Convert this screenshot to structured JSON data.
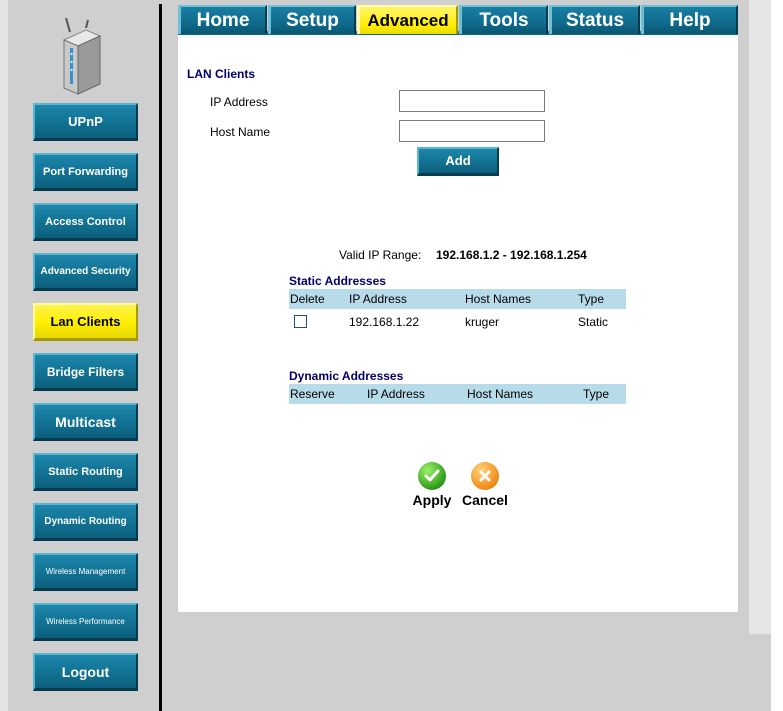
{
  "tabs": [
    {
      "label": "Home"
    },
    {
      "label": "Setup"
    },
    {
      "label": "Advanced"
    },
    {
      "label": "Tools"
    },
    {
      "label": "Status"
    },
    {
      "label": "Help"
    }
  ],
  "active_tab": "Advanced",
  "sidebar": {
    "items": [
      {
        "label": "UPnP"
      },
      {
        "label": "Port Forwarding"
      },
      {
        "label": "Access Control"
      },
      {
        "label": "Advanced Security"
      },
      {
        "label": "Lan Clients"
      },
      {
        "label": "Bridge Filters"
      },
      {
        "label": "Multicast"
      },
      {
        "label": "Static Routing"
      },
      {
        "label": "Dynamic Routing"
      },
      {
        "label": "Wireless Management"
      },
      {
        "label": "Wireless Performance"
      },
      {
        "label": "Logout"
      }
    ],
    "active": "Lan Clients"
  },
  "lan_clients": {
    "title": "LAN Clients",
    "ip_label": "IP Address",
    "ip_value": "",
    "host_label": "Host Name",
    "host_value": "",
    "add_label": "Add"
  },
  "valid_range": {
    "label": "Valid IP Range:",
    "value": "192.168.1.2 - 192.168.1.254"
  },
  "static_table": {
    "title": "Static Addresses",
    "headers": [
      "Delete",
      "IP Address",
      "Host Names",
      "Type"
    ],
    "rows": [
      {
        "ip": "192.168.1.22",
        "host": "kruger",
        "type": "Static",
        "checked": false
      }
    ]
  },
  "dynamic_table": {
    "title": "Dynamic Addresses",
    "headers": [
      "Reserve",
      "IP Address",
      "Host Names",
      "Type"
    ],
    "rows": []
  },
  "actions": {
    "apply_label": "Apply",
    "cancel_label": "Cancel"
  },
  "colors": {
    "nav_blue": "#0f6a8c",
    "active_yellow": "#ffee00",
    "table_header": "#b7dbe8",
    "title_navy": "#000066"
  },
  "icons": {
    "router": "router-device-icon",
    "apply": "green-checkmark-icon",
    "cancel": "orange-x-icon"
  }
}
